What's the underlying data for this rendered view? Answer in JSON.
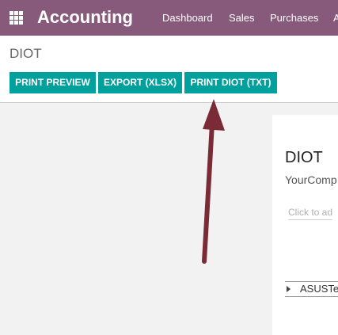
{
  "navbar": {
    "app_title": "Accounting",
    "menu": [
      "Dashboard",
      "Sales",
      "Purchases",
      "A"
    ]
  },
  "control_panel": {
    "title": "DIOT",
    "buttons": [
      "PRINT PREVIEW",
      "EXPORT (XLSX)",
      "PRINT DIOT (TXT)"
    ]
  },
  "report": {
    "title": "DIOT",
    "company": "YourComp",
    "filter_placeholder": "Click to ad",
    "line": "ASUSTe"
  },
  "colors": {
    "navbar": "#875a7b",
    "button": "#00a09d",
    "annotation_arrow": "#7a2b35"
  }
}
